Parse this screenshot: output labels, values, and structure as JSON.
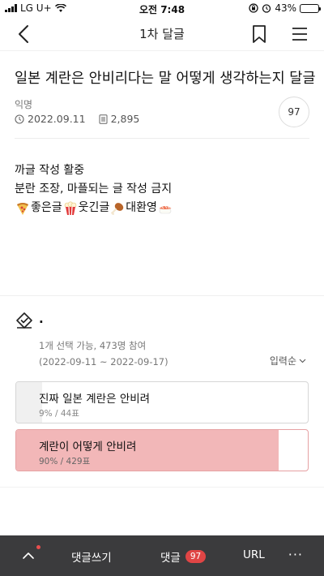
{
  "status": {
    "carrier": "LG U+",
    "time": "오전 7:48",
    "battery": "43%",
    "battery_level": 0.43
  },
  "nav": {
    "title": "1차 달글"
  },
  "post": {
    "title": "일본 계란은 안비리다는 말 어떻게 생각하는지 달글",
    "author": "익명",
    "date": "2022.09.11",
    "views": "2,895",
    "comment_count": "97"
  },
  "content": {
    "line1": "까글 작성 활중",
    "line2": "분란 조장, 마플되는 글 작성 금지",
    "good": "좋은글",
    "funny": "웃긴글",
    "welcome": "대환영"
  },
  "poll": {
    "title": ".",
    "info": "1개 선택 가능, 473명 참여",
    "period": "(2022-09-11 ~ 2022-09-17)",
    "sort_label": "입력순",
    "options": [
      {
        "label": "진짜 일본 계란은 안비려",
        "stats": "9% / 44표",
        "fraction": 0.09,
        "color": "#f0f0f0"
      },
      {
        "label": "계란이 어떻게 안비려",
        "stats": "90% / 429표",
        "fraction": 0.9,
        "color": "#f2b7b8"
      }
    ]
  },
  "bottom": {
    "write": "댓글쓰기",
    "comments": "댓글",
    "comments_count": "97",
    "url": "URL",
    "more": "···"
  }
}
